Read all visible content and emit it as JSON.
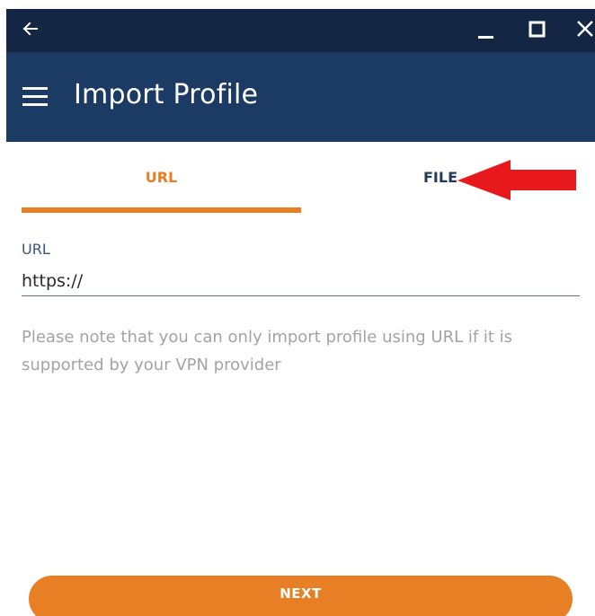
{
  "window": {
    "back_icon": "arrow-left-icon",
    "minimize_icon": "minimize-icon",
    "maximize_icon": "maximize-icon",
    "close_icon": "close-icon"
  },
  "appbar": {
    "menu_icon": "hamburger-menu-icon",
    "title": "Import Profile"
  },
  "tabs": [
    {
      "label": "URL",
      "active": true
    },
    {
      "label": "FILE",
      "active": false
    }
  ],
  "annotation": {
    "arrow_icon": "red-arrow-annotation",
    "color": "#e8191c"
  },
  "form": {
    "url_label": "URL",
    "url_value": "https://"
  },
  "note": "Please note that you can only import profile using URL if it is supported by your VPN provider",
  "next_label": "NEXT",
  "colors": {
    "titlebar": "#132744",
    "appbar": "#1b3a64",
    "accent": "#e87f24",
    "tab_inactive": "#23395d",
    "note_text": "#a3a3a3"
  }
}
